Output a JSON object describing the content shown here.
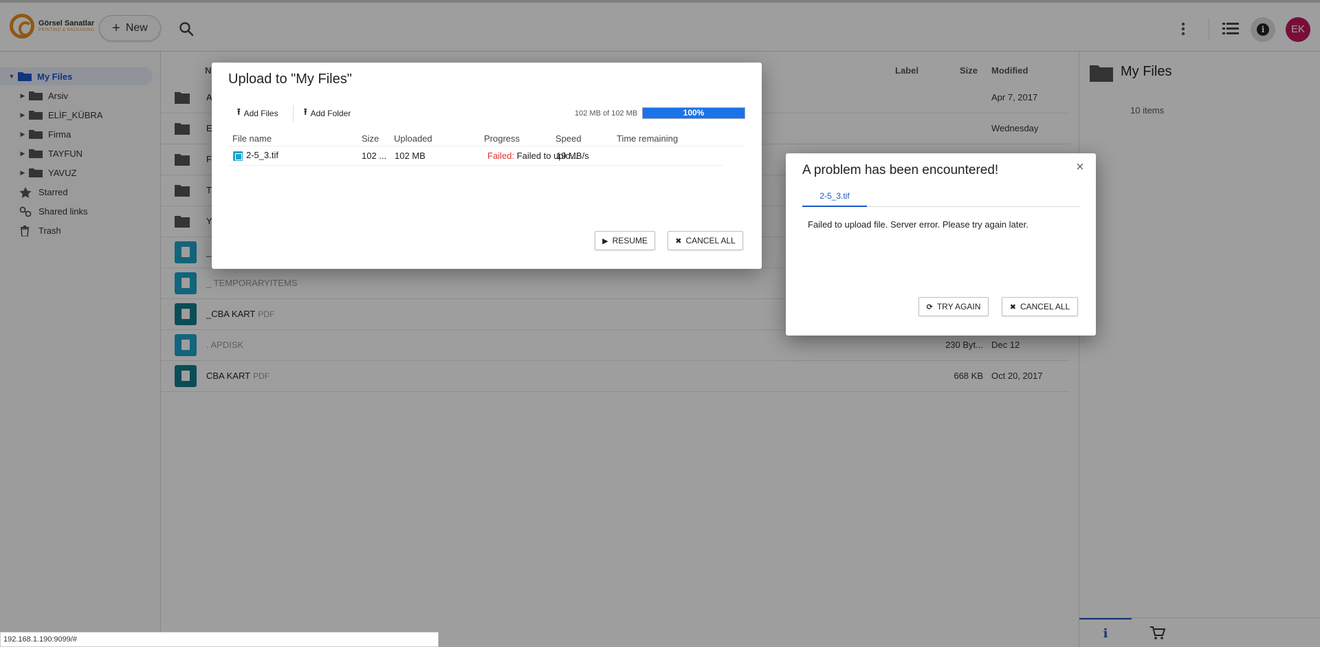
{
  "header": {
    "logo_name": "Görsel Sanatlar",
    "logo_sub": "PRINTING & PACKAGING",
    "new_label": "New",
    "avatar_initials": "EK"
  },
  "sidebar": {
    "root": "My Files",
    "folders": [
      "Arsiv",
      "ELİF_KÜBRA",
      "Firma",
      "TAYFUN",
      "YAVUZ"
    ],
    "starred": "Starred",
    "shared_links": "Shared links",
    "trash": "Trash"
  },
  "main": {
    "columns": {
      "name": "N",
      "label": "Label",
      "size": "Size",
      "modified": "Modified"
    },
    "rows": [
      {
        "name": "A",
        "ext": "",
        "size": "",
        "modified": "Apr 7, 2017",
        "kind": "folder"
      },
      {
        "name": "E",
        "ext": "",
        "size": "",
        "modified": "Wednesday",
        "kind": "folder"
      },
      {
        "name": "F",
        "ext": "",
        "size": "",
        "modified": "",
        "kind": "folder"
      },
      {
        "name": "T",
        "ext": "",
        "size": "",
        "modified": "",
        "kind": "folder"
      },
      {
        "name": "Y",
        "ext": "",
        "size": "",
        "modified": "",
        "kind": "folder"
      },
      {
        "name": "_",
        "ext": "",
        "size": "",
        "modified": "",
        "kind": "doc"
      },
      {
        "name": "_ TEMPORARYITEMS",
        "ext": "",
        "size": "",
        "modified": "",
        "kind": "doc"
      },
      {
        "name": "_CBA KART",
        "ext": "PDF",
        "size": "",
        "modified": "",
        "kind": "image"
      },
      {
        "name": ". APDISK",
        "ext": "",
        "size": "230 Byt...",
        "modified": "Dec 12",
        "kind": "doc"
      },
      {
        "name": "CBA KART",
        "ext": "PDF",
        "size": "668 KB",
        "modified": "Oct 20, 2017",
        "kind": "image"
      }
    ]
  },
  "details": {
    "title": "My Files",
    "count": "10 items"
  },
  "statusbar": {
    "url": "192.168.1.190:9099/#"
  },
  "upload": {
    "title": "Upload to \"My Files\"",
    "add_files": "Add Files",
    "add_folder": "Add Folder",
    "progress_text": "102 MB of 102 MB",
    "progress_label": "100%",
    "progress_fraction": 1.0,
    "columns": {
      "file_name": "File name",
      "size": "Size",
      "uploaded": "Uploaded",
      "progress": "Progress",
      "speed": "Speed",
      "time_remaining": "Time remaining"
    },
    "row": {
      "file_name": "2-5_3.tif",
      "size": "102 ...",
      "uploaded": "102 MB",
      "status": "Failed:",
      "status_detail": "Failed to uplo...",
      "speed": "19 MB/s",
      "time_remaining": ""
    },
    "resume": "RESUME",
    "cancel_all": "CANCEL ALL"
  },
  "error": {
    "title": "A problem has been encountered!",
    "tab": "2-5_3.tif",
    "message": "Failed to upload file. Server error. Please try again later.",
    "try_again": "TRY AGAIN",
    "cancel_all": "CANCEL ALL"
  },
  "colors": {
    "accent": "#1a56c8",
    "progress": "#1a73e8",
    "failed": "#e03030",
    "avatar": "#c2185b",
    "logo": "#e98f1e"
  }
}
